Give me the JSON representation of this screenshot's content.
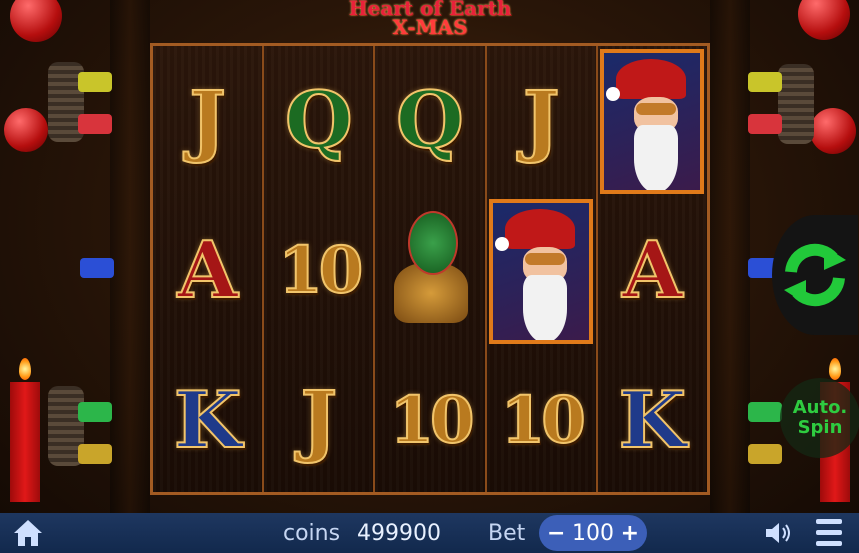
{
  "title": {
    "line1": "Heart of Earth",
    "line2": "X-MAS"
  },
  "reels": [
    [
      {
        "symbol": "J",
        "color": "gold"
      },
      {
        "symbol": "A",
        "color": "red"
      },
      {
        "symbol": "K",
        "color": "blue"
      }
    ],
    [
      {
        "symbol": "Q",
        "color": "green"
      },
      {
        "symbol": "10",
        "color": "gold"
      },
      {
        "symbol": "J",
        "color": "gold"
      }
    ],
    [
      {
        "symbol": "Q",
        "color": "green"
      },
      {
        "symbol": "tree-scatter",
        "color": "green"
      },
      {
        "symbol": "10",
        "color": "gold"
      }
    ],
    [
      {
        "symbol": "J",
        "color": "gold"
      },
      {
        "symbol": "santa-wild",
        "color": "red"
      },
      {
        "symbol": "10",
        "color": "gold"
      }
    ],
    [
      {
        "symbol": "santa-wild",
        "color": "red"
      },
      {
        "symbol": "A",
        "color": "red"
      },
      {
        "symbol": "K",
        "color": "blue"
      }
    ]
  ],
  "buttons": {
    "spin_icon": "refresh-icon",
    "auto_spin": "Auto.\nSpin"
  },
  "bottom_bar": {
    "coins_label": "coins",
    "coins_value": "499900",
    "bet_label": "Bet",
    "bet_value": "100",
    "bet_minus": "−",
    "bet_plus": "+"
  },
  "colors": {
    "accent_green": "#2ecc40",
    "bar_blue": "#1e3760",
    "bet_pill": "#3c5fb8",
    "frame": "#a35b22"
  }
}
